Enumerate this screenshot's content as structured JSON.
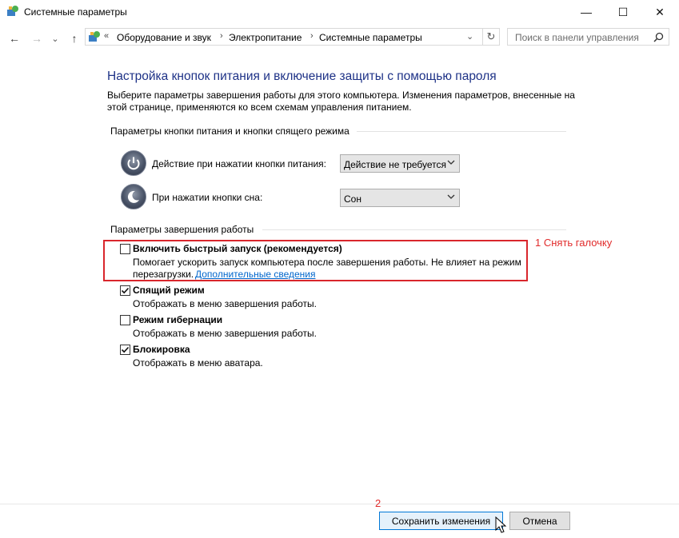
{
  "window": {
    "title": "Системные параметры",
    "controls": {
      "minimize": "—",
      "maximize": "☐",
      "close": "✕"
    }
  },
  "navbar": {
    "back": "←",
    "forward": "→",
    "recent": "⌄",
    "up": "↑",
    "breadcrumb_overflow": "«",
    "breadcrumbs": [
      "Оборудование и звук",
      "Электропитание",
      "Системные параметры"
    ],
    "refresh": "↻",
    "search_placeholder": "Поиск в панели управления"
  },
  "main": {
    "heading": "Настройка кнопок питания и включение защиты с помощью пароля",
    "description": "Выберите параметры завершения работы для этого компьютера. Изменения параметров, внесенные на этой странице, применяются ко всем схемам управления питанием.",
    "power_group": {
      "title": "Параметры кнопки питания и кнопки спящего режима",
      "power_button": {
        "label": "Действие при нажатии кнопки питания:",
        "value": "Действие не требуется"
      },
      "sleep_button": {
        "label": "При нажатии кнопки сна:",
        "value": "Сон"
      }
    },
    "shutdown_group": {
      "title": "Параметры завершения работы",
      "options": [
        {
          "title": "Включить быстрый запуск (рекомендуется)",
          "desc": "Помогает ускорить запуск компьютера после завершения работы. Не влияет на режим",
          "desc2": "перезагрузки.",
          "link": "Дополнительные сведения",
          "checked": false
        },
        {
          "title": "Спящий режим",
          "desc": "Отображать в меню завершения работы.",
          "checked": true
        },
        {
          "title": "Режим гибернации",
          "desc": "Отображать в меню завершения работы.",
          "checked": false
        },
        {
          "title": "Блокировка",
          "desc": "Отображать в меню аватара.",
          "checked": true
        }
      ]
    }
  },
  "annotations": {
    "step1": "1 Снять галочку",
    "step2": "2",
    "color": "#e12b2b"
  },
  "footer": {
    "save_label": "Сохранить изменения",
    "cancel_label": "Отмена"
  },
  "colors": {
    "heading": "#1e3287",
    "link": "#0066cc",
    "highlight_box": "#d9262c",
    "primary_button_border": "#0078d7"
  }
}
